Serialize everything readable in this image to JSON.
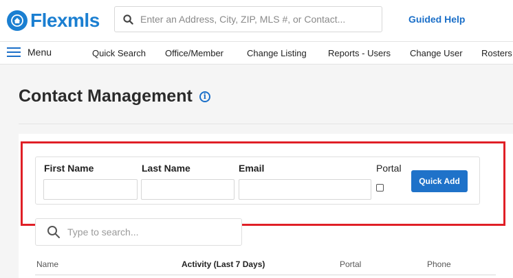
{
  "header": {
    "logo_text": "Flexmls",
    "search_placeholder": "Enter an Address, City, ZIP, MLS #, or Contact...",
    "guided_help": "Guided Help"
  },
  "nav": {
    "menu_label": "Menu",
    "items": [
      "Quick Search",
      "Office/Member",
      "Change Listing",
      "Reports - Users",
      "Change User",
      "Rosters"
    ]
  },
  "page": {
    "title": "Contact Management",
    "info_glyph": "i"
  },
  "quick_add": {
    "first_name_label": "First Name",
    "last_name_label": "Last Name",
    "email_label": "Email",
    "portal_label": "Portal",
    "button_label": "Quick Add"
  },
  "list": {
    "search_placeholder": "Type to search...",
    "columns": [
      "Name",
      "Activity (Last 7 Days)",
      "Portal",
      "Phone"
    ]
  },
  "colors": {
    "brand_blue": "#1b7fd1",
    "button_blue": "#1f72c9",
    "highlight_red": "#e01f26"
  }
}
